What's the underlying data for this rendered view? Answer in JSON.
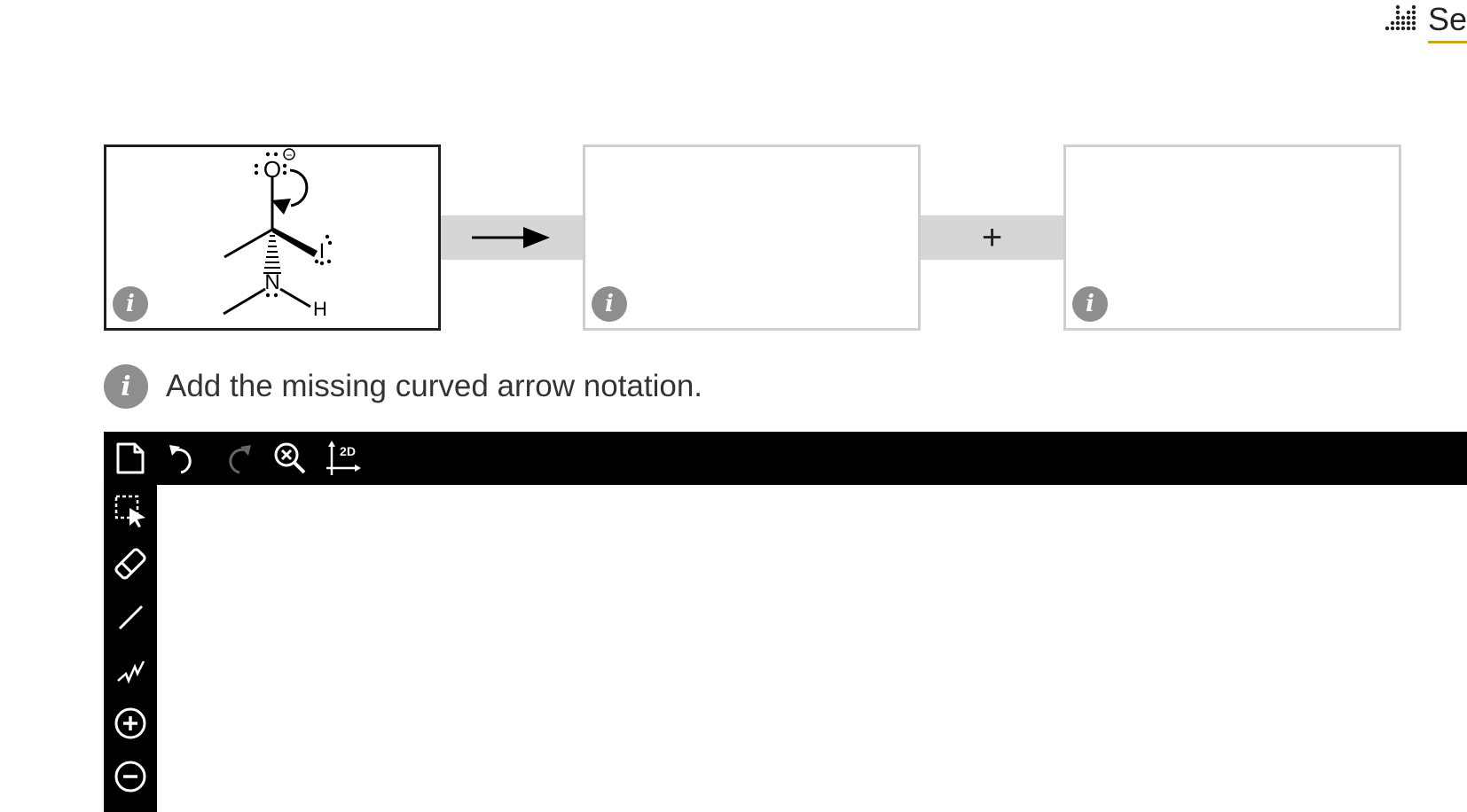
{
  "header": {
    "corner_link_label": "See",
    "corner_icon": "dotted-bars-icon"
  },
  "reaction": {
    "reactant": {
      "atoms": {
        "oxygen": "O",
        "iodine": "I",
        "nitrogen": "N",
        "hydrogen": "H",
        "charge": "−"
      },
      "info_label": "i"
    },
    "arrow_icon": "reaction-arrow-icon",
    "product_1": {
      "info_label": "i"
    },
    "separator": "+",
    "product_2": {
      "info_label": "i"
    }
  },
  "instruction": {
    "info_label": "i",
    "text": "Add the missing curved arrow notation."
  },
  "toolbar": {
    "tools": [
      "new-document-icon",
      "undo-icon",
      "redo-icon",
      "zoom-reset-icon",
      "clean-2d-icon"
    ],
    "clean_2d_label": "2D"
  },
  "sidebar": {
    "tools": [
      "select-icon",
      "eraser-icon",
      "bond-icon",
      "chain-icon",
      "plus-charge-icon",
      "minus-charge-icon"
    ]
  }
}
